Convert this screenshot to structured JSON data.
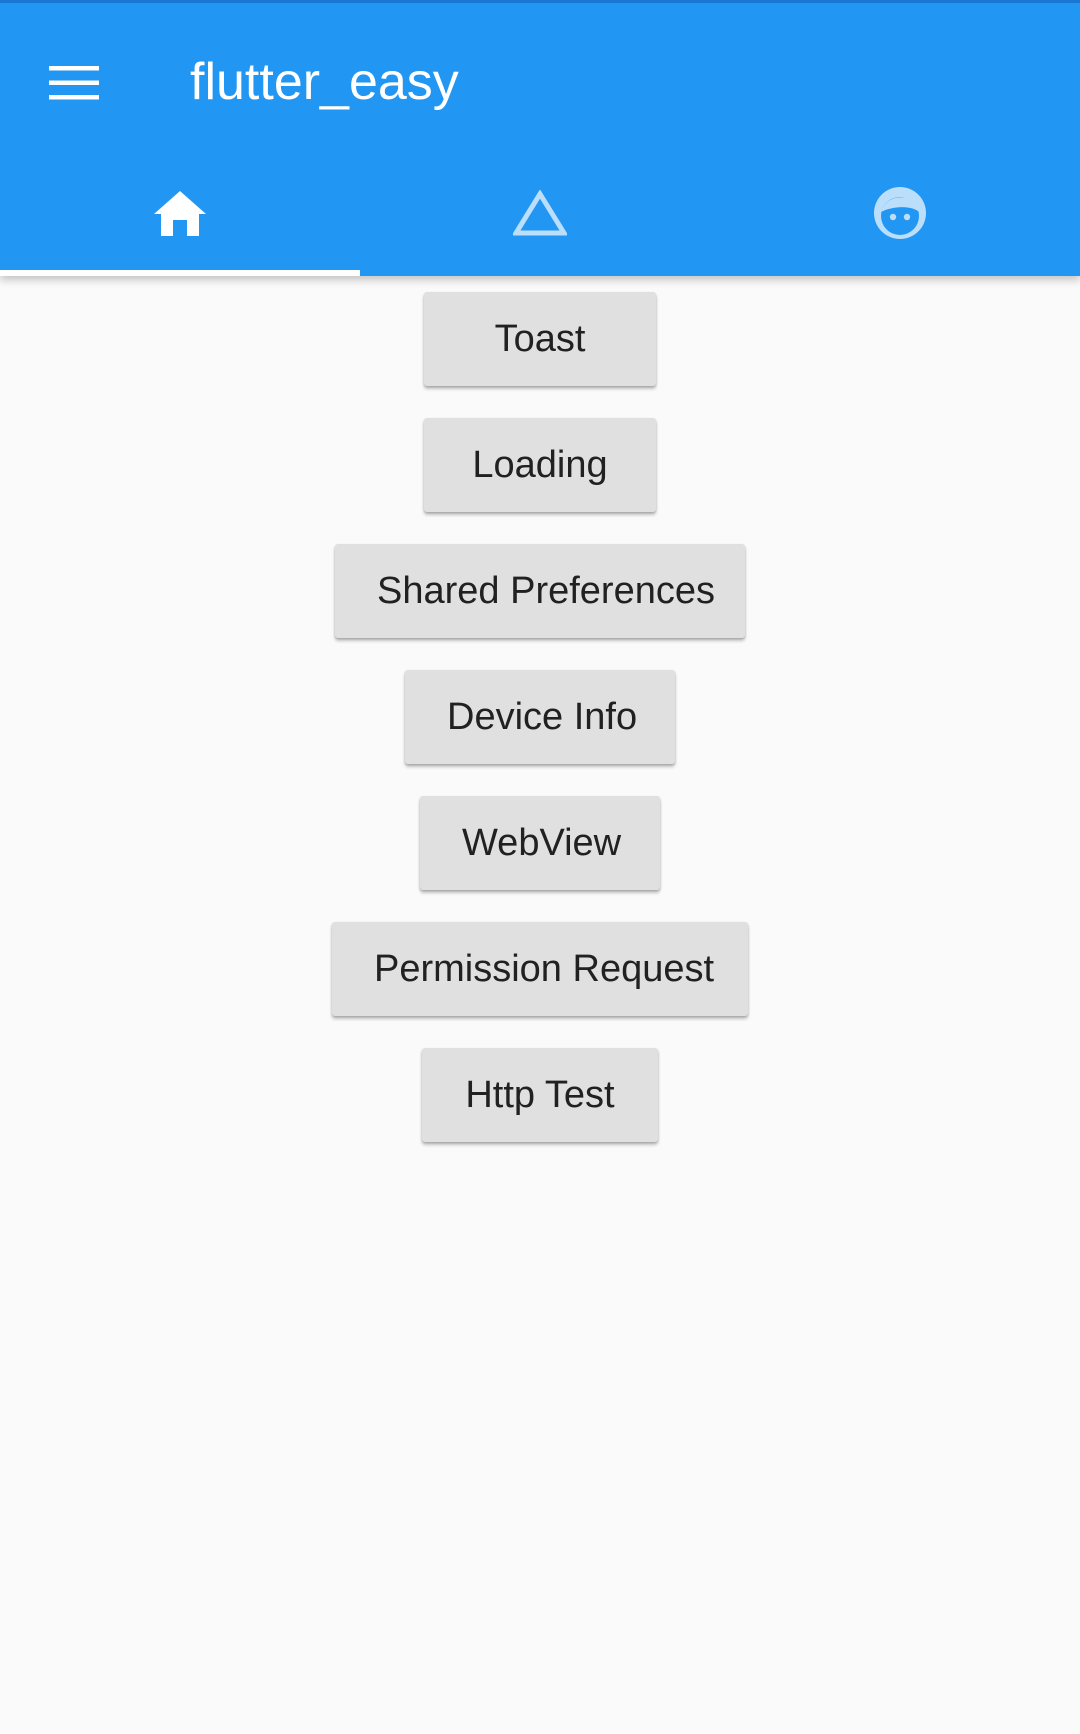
{
  "appbar": {
    "title": "flutter_easy",
    "background_color": "#2196f3",
    "menu_icon": "menu-icon"
  },
  "tabs": [
    {
      "name": "home",
      "icon": "home-icon",
      "selected": true
    },
    {
      "name": "triangle",
      "icon": "triangle-icon",
      "selected": false
    },
    {
      "name": "face",
      "icon": "face-icon",
      "selected": false
    }
  ],
  "buttons": [
    {
      "label": "Toast"
    },
    {
      "label": "Loading"
    },
    {
      "label": "Shared Preferences"
    },
    {
      "label": "Device Info"
    },
    {
      "label": "WebView"
    },
    {
      "label": "Permission Request"
    },
    {
      "label": "Http Test"
    }
  ]
}
